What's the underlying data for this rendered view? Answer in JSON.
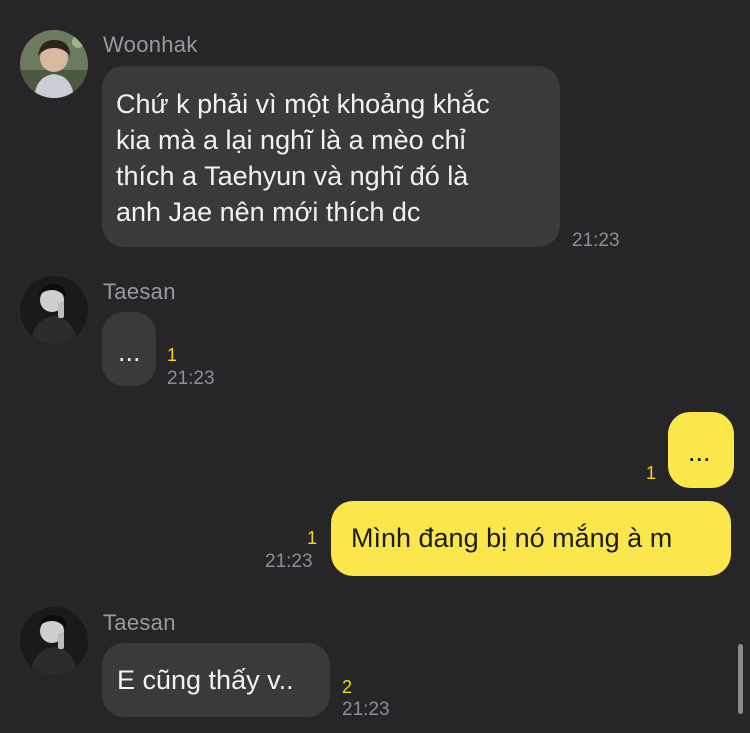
{
  "messages": [
    {
      "sender": "Woonhak",
      "text_lines": [
        "Chứ k phải vì một khoảng khắc",
        "kia mà a lại nghĩ là a mèo chỉ",
        "thích a Taehyun và nghĩ đó là",
        "anh Jae nên mới thích dc"
      ],
      "time": "21:23"
    },
    {
      "sender": "Taesan",
      "text": "...",
      "unread": "1",
      "time": "21:23"
    },
    {
      "sender": "me",
      "text": "...",
      "unread": "1"
    },
    {
      "sender": "me",
      "text": "Mình đang bị nó mắng à m",
      "unread": "1",
      "time": "21:23"
    },
    {
      "sender": "Taesan",
      "text": "E cũng thấy v..",
      "unread": "2",
      "time": "21:23"
    }
  ],
  "colors": {
    "background": "#262628",
    "incoming_bubble": "#3a3a3c",
    "outgoing_bubble": "#fbe64b",
    "unread_count": "#f5d90a"
  }
}
